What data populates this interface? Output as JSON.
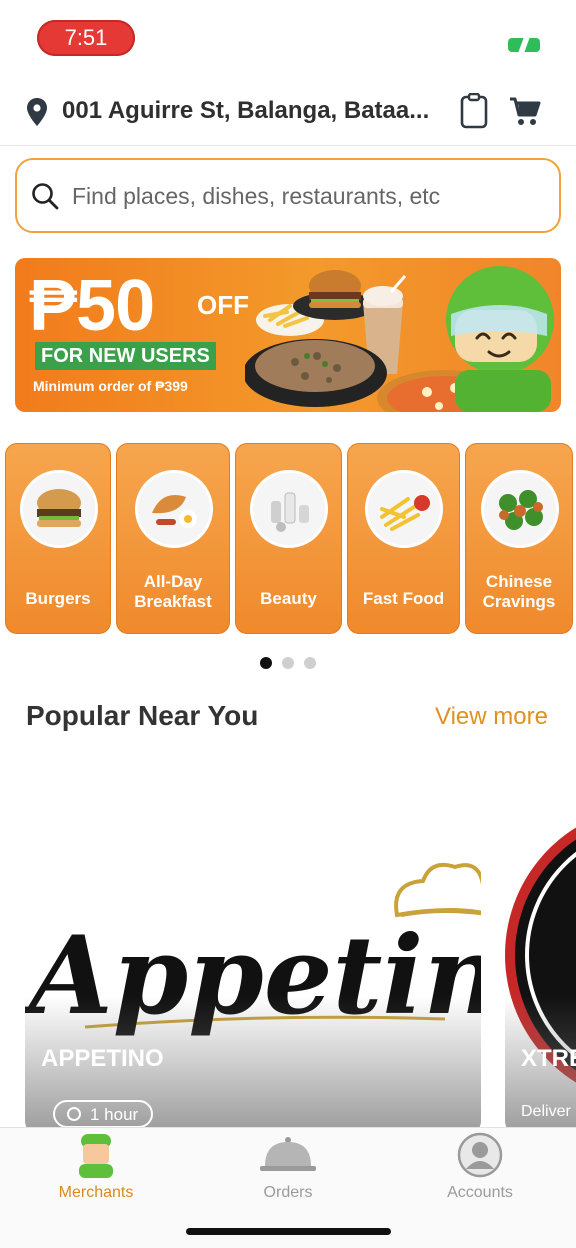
{
  "status": {
    "time": "7:51"
  },
  "header": {
    "address": "001 Aguirre St, Balanga, Bataa..."
  },
  "search": {
    "placeholder": "Find places, dishes, restaurants, etc"
  },
  "promo": {
    "amount": "₱50",
    "off": "OFF",
    "tag": "FOR NEW USERS",
    "minimum": "Minimum order of ₱399"
  },
  "categories": [
    {
      "label": "Burgers",
      "icon": "burger-icon"
    },
    {
      "label": "All-Day Breakfast",
      "icon": "breakfast-icon"
    },
    {
      "label": "Beauty",
      "icon": "beauty-icon"
    },
    {
      "label": "Fast Food",
      "icon": "fries-icon"
    },
    {
      "label": "Chinese Cravings",
      "icon": "broccoli-icon"
    }
  ],
  "carousel": {
    "active_index": 0,
    "count": 3
  },
  "popular": {
    "title": "Popular Near You",
    "view_more": "View more",
    "restaurants": [
      {
        "logo_text": "Appetino",
        "name": "APPETINO",
        "time": "1 hour"
      },
      {
        "name": "XTRE",
        "sub": "Deliver"
      }
    ]
  },
  "nav": {
    "items": [
      {
        "label": "Merchants",
        "active": true
      },
      {
        "label": "Orders",
        "active": false
      },
      {
        "label": "Accounts",
        "active": false
      }
    ]
  },
  "colors": {
    "accent": "#f08a2c",
    "active_nav": "#d88a1f",
    "promo_green": "#3aa14a"
  }
}
